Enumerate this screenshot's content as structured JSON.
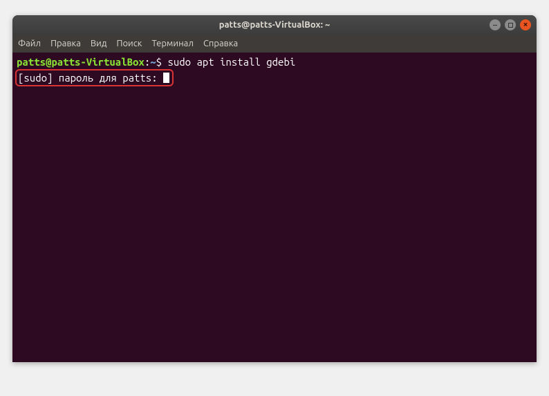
{
  "window": {
    "title": "patts@patts-VirtualBox: ~"
  },
  "menubar": {
    "items": [
      {
        "label": "Файл"
      },
      {
        "label": "Правка"
      },
      {
        "label": "Вид"
      },
      {
        "label": "Поиск"
      },
      {
        "label": "Терминал"
      },
      {
        "label": "Справка"
      }
    ]
  },
  "terminal": {
    "prompt_userhost": "patts@patts-VirtualBox",
    "prompt_separator": ":",
    "prompt_path": "~",
    "prompt_symbol": "$ ",
    "command": "sudo apt install gdebi",
    "sudo_line": "[sudo] пароль для patts: "
  },
  "colors": {
    "terminal_bg": "#2d0922",
    "highlight_border": "#d93434",
    "close_btn": "#e95420"
  }
}
